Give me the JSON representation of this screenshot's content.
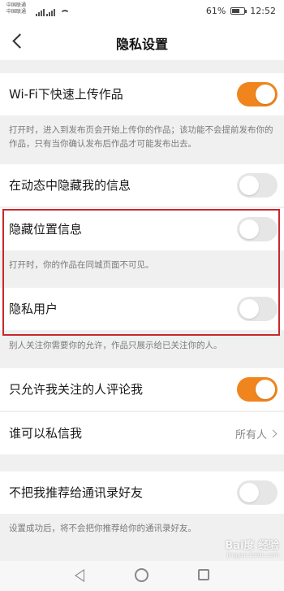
{
  "status_bar": {
    "carrier_1": "中国联通",
    "carrier_2": "中国联通",
    "battery": "61%",
    "time": "12:52",
    "battery_level": 0.61
  },
  "nav": {
    "title": "隐私设置"
  },
  "settings": {
    "wifi_upload": {
      "label": "Wi-Fi下快速上传作品",
      "on": true,
      "desc": "打开时，进入到发布页会开始上传你的作品；该功能不会提前发布你的作品，只有当你确认发布后作品才可能发布出去。"
    },
    "hide_activity": {
      "label": "在动态中隐藏我的信息",
      "on": false
    },
    "hide_location": {
      "label": "隐藏位置信息",
      "on": false,
      "desc": "打开时，你的作品在同城页面不可见。"
    },
    "private_user": {
      "label": "隐私用户",
      "on": false,
      "desc": "别人关注你需要你的允许，作品只展示给已关注你的人。"
    },
    "comment_followed_only": {
      "label": "只允许我关注的人评论我",
      "on": true
    },
    "who_can_message": {
      "label": "谁可以私信我",
      "value": "所有人"
    },
    "no_recommend_contacts": {
      "label": "不把我推荐给通讯录好友",
      "on": false,
      "desc": "设置成功后，将不会把你推荐给你的通讯录好友。"
    }
  },
  "watermark": {
    "main": "Bai度 经验",
    "sub": "jingyan.baidu.com"
  },
  "colors": {
    "accent": "#f0851e",
    "highlight": "#c8282d"
  },
  "icons": [
    "back-arrow-icon",
    "signal-icon",
    "wifi-icon",
    "battery-icon",
    "chevron-right-icon",
    "nav-back-icon",
    "nav-home-icon",
    "nav-recent-icon"
  ]
}
